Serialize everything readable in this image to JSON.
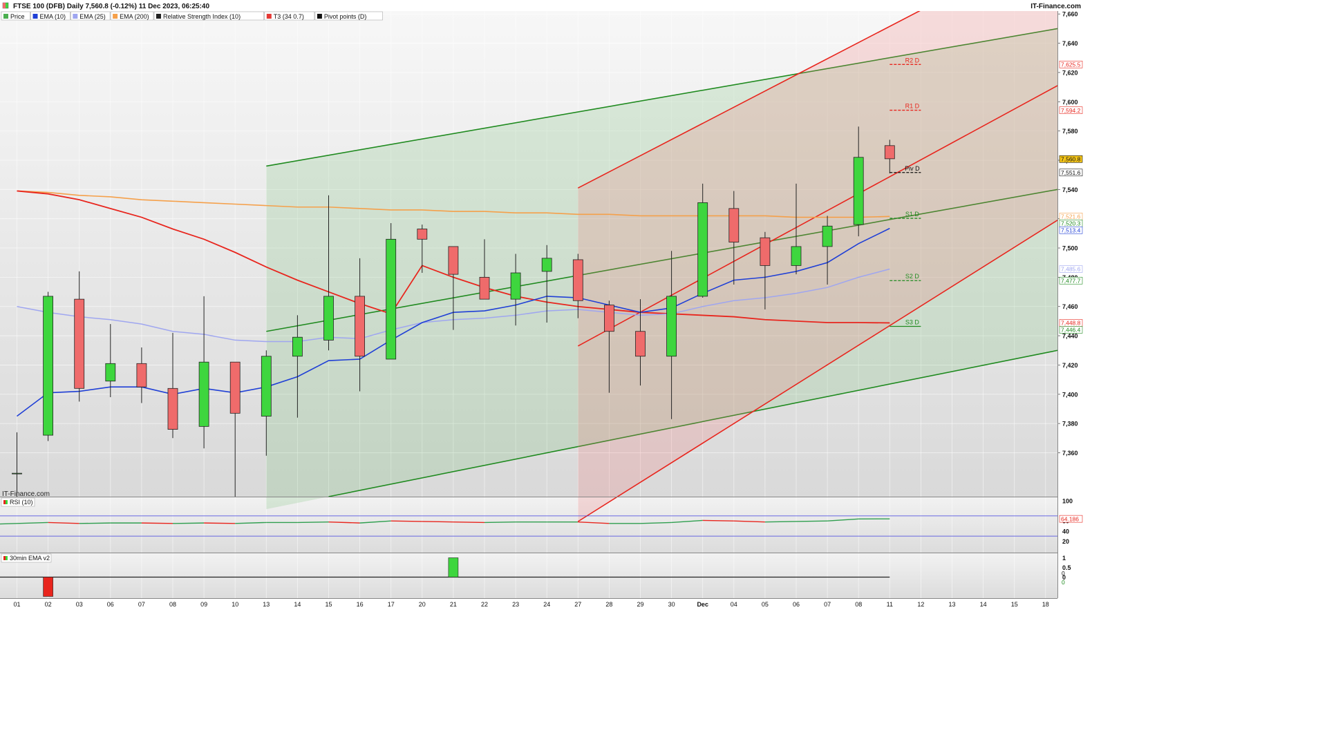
{
  "header": {
    "title": "FTSE 100 (DFB) Daily 7,560.8 (-0.12%) 11 Dec 2023, 06:25:40",
    "brand": "IT-Finance.com",
    "watermark": "IT-Finance.com"
  },
  "legend": [
    {
      "label": "Price",
      "color": "#4caf50"
    },
    {
      "label": "EMA (10)",
      "color": "#1f3fd6"
    },
    {
      "label": "EMA (25)",
      "color": "#9fa6f0"
    },
    {
      "label": "EMA (200)",
      "color": "#f5a04a"
    },
    {
      "label": "Relative Strength Index (10)",
      "color": "#222222"
    },
    {
      "label": "T3 (34 0.7)",
      "color": "#e53935"
    },
    {
      "label": "Pivot points (D)",
      "color": "#111111"
    }
  ],
  "colors": {
    "up": "#3ed63e",
    "down": "#ef6b6b",
    "ema10": "#1f3fd6",
    "ema25": "#9fa6f0",
    "ema200": "#f5a04a",
    "t3": "#e8251d",
    "channel_green": "#1f8a1f",
    "channel_red": "#e8251d",
    "rsi_up": "#2e9e4e",
    "rsi_down": "#e8251d"
  },
  "chart_data": [
    {
      "type": "candlestick",
      "x": [
        "01",
        "02",
        "03",
        "06",
        "07",
        "08",
        "09",
        "10",
        "13",
        "14",
        "15",
        "16",
        "17",
        "20",
        "21",
        "22",
        "23",
        "24",
        "27",
        "28",
        "29",
        "30",
        "Dec",
        "04",
        "05",
        "06",
        "07",
        "08",
        "11"
      ],
      "x_future": [
        "12",
        "13",
        "14",
        "15",
        "18"
      ],
      "ohlc": [
        [
          7346,
          7374,
          7330,
          7346
        ],
        [
          7372,
          7470,
          7368,
          7467
        ],
        [
          7465,
          7484,
          7395,
          7404
        ],
        [
          7409,
          7448,
          7398,
          7421
        ],
        [
          7421,
          7432,
          7394,
          7405
        ],
        [
          7404,
          7442,
          7370,
          7376
        ],
        [
          7378,
          7467,
          7363,
          7422
        ],
        [
          7422,
          7422,
          7330,
          7387
        ],
        [
          7385,
          7430,
          7358,
          7426
        ],
        [
          7426,
          7454,
          7384,
          7439
        ],
        [
          7437,
          7536,
          7430,
          7467
        ],
        [
          7467,
          7493,
          7402,
          7426
        ],
        [
          7424,
          7517,
          7424,
          7506
        ],
        [
          7513,
          7516,
          7483,
          7506
        ],
        [
          7501,
          7501,
          7444,
          7482
        ],
        [
          7480,
          7506,
          7472,
          7465
        ],
        [
          7465,
          7496,
          7447,
          7483
        ],
        [
          7484,
          7502,
          7449,
          7493
        ],
        [
          7492,
          7496,
          7452,
          7464
        ],
        [
          7461,
          7464,
          7401,
          7443
        ],
        [
          7443,
          7465,
          7406,
          7426
        ],
        [
          7426,
          7498,
          7383,
          7467
        ],
        [
          7467,
          7544,
          7466,
          7531
        ],
        [
          7527,
          7539,
          7475,
          7504
        ],
        [
          7507,
          7511,
          7458,
          7488
        ],
        [
          7488,
          7544,
          7482,
          7501
        ],
        [
          7501,
          7522,
          7475,
          7515
        ],
        [
          7516,
          7583,
          7508,
          7562
        ],
        [
          7570,
          7574,
          7551,
          7561
        ]
      ],
      "ema10": [
        7385,
        7401,
        7402,
        7405,
        7405,
        7400,
        7404,
        7401,
        7405,
        7412,
        7423,
        7424,
        7437,
        7449,
        7456,
        7457,
        7461,
        7467,
        7466,
        7461,
        7456,
        7459,
        7469,
        7478,
        7480,
        7484,
        7490,
        7503,
        7513.4
      ],
      "ema25": [
        7460,
        7456,
        7453,
        7451,
        7448,
        7443,
        7441,
        7437,
        7436,
        7436,
        7439,
        7438,
        7444,
        7449,
        7451,
        7452,
        7454,
        7457,
        7458,
        7456,
        7454,
        7455,
        7460,
        7464,
        7466,
        7469,
        7473,
        7480,
        7485.6
      ],
      "ema200": [
        7539,
        7538,
        7536,
        7535,
        7533,
        7532,
        7531,
        7530,
        7529,
        7528,
        7528,
        7527,
        7526,
        7526,
        7525,
        7525,
        7524,
        7524,
        7523,
        7523,
        7522,
        7522,
        7522,
        7522,
        7522,
        7521,
        7521,
        7521,
        7521.6
      ],
      "t3": [
        7539,
        7537,
        7533,
        7527,
        7521,
        7513,
        7506,
        7497,
        7487,
        7478,
        7470,
        7462,
        7455,
        7488,
        7480,
        7473,
        7467,
        7463,
        7460,
        7458,
        7456,
        7455,
        7454,
        7453,
        7451,
        7450,
        7449,
        7449,
        7448.8
      ],
      "pivots": [
        {
          "name": "R2 D",
          "value": 7625.5
        },
        {
          "name": "R1 D",
          "value": 7594.2
        },
        {
          "name": "Piv D",
          "value": 7551.6
        },
        {
          "name": "S1 D",
          "value": 7520.3
        },
        {
          "name": "S2 D",
          "value": 7477.7
        },
        {
          "name": "S3 D",
          "value": 7446.4
        }
      ],
      "channels": [
        {
          "color": "green",
          "upper": [
            [
              "13",
              7556
            ],
            [
              "axis_end",
              7650
            ]
          ],
          "middle": [
            [
              "13",
              7443
            ],
            [
              "axis_end",
              7540
            ]
          ],
          "lower": [
            [
              "15",
              7330
            ],
            [
              "axis_end",
              7430
            ]
          ]
        },
        {
          "color": "red",
          "upper": [
            [
              "27",
              7541
            ],
            [
              "axis_end",
              7711
            ]
          ],
          "middle": [
            [
              "27",
              7433
            ],
            [
              "axis_end",
              7611
            ]
          ],
          "lower": [
            [
              "27",
              7313
            ],
            [
              "axis_end",
              7519
            ]
          ]
        }
      ],
      "ylim": [
        7330,
        7662
      ],
      "y_ticks": [
        7360,
        7380,
        7400,
        7420,
        7440,
        7460,
        7480,
        7500,
        7520,
        7540,
        7560,
        7580,
        7600,
        7620,
        7640,
        7660
      ],
      "y_tick_labels": [
        "7,360",
        "7,380",
        "7,400",
        "7,420",
        "7,440",
        "7,460",
        "7,480",
        "7,500",
        "7,520",
        "7,540",
        "7,560",
        "7,580",
        "7,600",
        "7,620",
        "7,640",
        "7,660"
      ],
      "right_labels": [
        {
          "text": "7,625.5",
          "value": 7625.5,
          "color": "#e8251d"
        },
        {
          "text": "7,594.2",
          "value": 7594.2,
          "color": "#e8251d"
        },
        {
          "text": "7,560.8",
          "value": 7560.8,
          "color": "#111111",
          "bg": "#f5c518"
        },
        {
          "text": "7,551.6",
          "value": 7551.6,
          "color": "#111111"
        },
        {
          "text": "7,521.6",
          "value": 7521.6,
          "color": "#f5a04a"
        },
        {
          "text": "7,520.3",
          "value": 7520.3,
          "color": "#1f8a1f"
        },
        {
          "text": "7,513.4",
          "value": 7513.4,
          "color": "#1f3fd6"
        },
        {
          "text": "7,485.6",
          "value": 7485.6,
          "color": "#9fa6f0"
        },
        {
          "text": "7,477.7",
          "value": 7477.7,
          "color": "#1f8a1f"
        },
        {
          "text": "7,448.8",
          "value": 7448.8,
          "color": "#e8251d"
        },
        {
          "text": "7,446.4",
          "value": 7446.4,
          "color": "#1f8a1f"
        }
      ]
    },
    {
      "type": "line",
      "title": "RSI (10)",
      "values": [
        54,
        57,
        55,
        56,
        56,
        55,
        56,
        55,
        57,
        57,
        58,
        56,
        60,
        59,
        58,
        57,
        58,
        58,
        58,
        55,
        55,
        57,
        61,
        60,
        58,
        59,
        60,
        64,
        64.186
      ],
      "ylim": [
        0,
        100
      ],
      "y_ticks": [
        20,
        40,
        60,
        100
      ],
      "y_tick_labels": [
        "20",
        "40",
        "60",
        "100"
      ],
      "levels": [
        30,
        70
      ],
      "last_label": "64.186"
    },
    {
      "type": "bar",
      "title": "30min EMA v2",
      "bars": [
        {
          "x": "02",
          "value": -1
        },
        {
          "x": "21",
          "value": 1
        }
      ],
      "ylim": [
        -1,
        1
      ],
      "y_ticks": [
        0,
        0.5,
        1
      ],
      "y_tick_labels": [
        "0",
        "0.5",
        "1"
      ],
      "last_labels": [
        "0",
        "0"
      ]
    }
  ]
}
